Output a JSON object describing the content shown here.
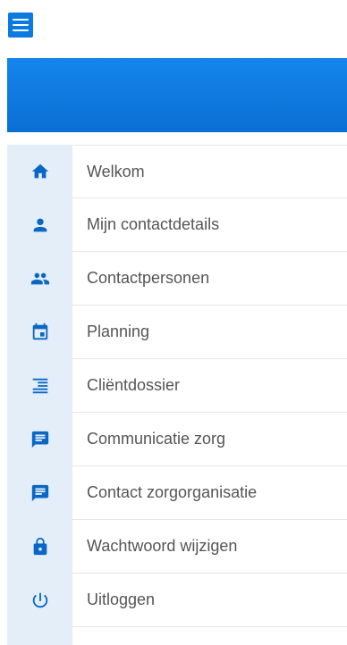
{
  "menu": {
    "items": [
      {
        "label": "Welkom",
        "icon": "home-icon"
      },
      {
        "label": "Mijn contactdetails",
        "icon": "person-icon"
      },
      {
        "label": "Contactpersonen",
        "icon": "people-icon"
      },
      {
        "label": "Planning",
        "icon": "calendar-icon"
      },
      {
        "label": "Cliëntdossier",
        "icon": "dossier-icon"
      },
      {
        "label": "Communicatie zorg",
        "icon": "chat-icon"
      },
      {
        "label": "Contact zorgorganisatie",
        "icon": "chat-icon"
      },
      {
        "label": "Wachtwoord wijzigen",
        "icon": "lock-icon"
      },
      {
        "label": "Uitloggen",
        "icon": "power-icon"
      }
    ]
  },
  "colors": {
    "accent": "#0b7be0",
    "icon": "#0a67c4",
    "icon_column_bg": "#e3eef9",
    "label_text": "#555555"
  }
}
